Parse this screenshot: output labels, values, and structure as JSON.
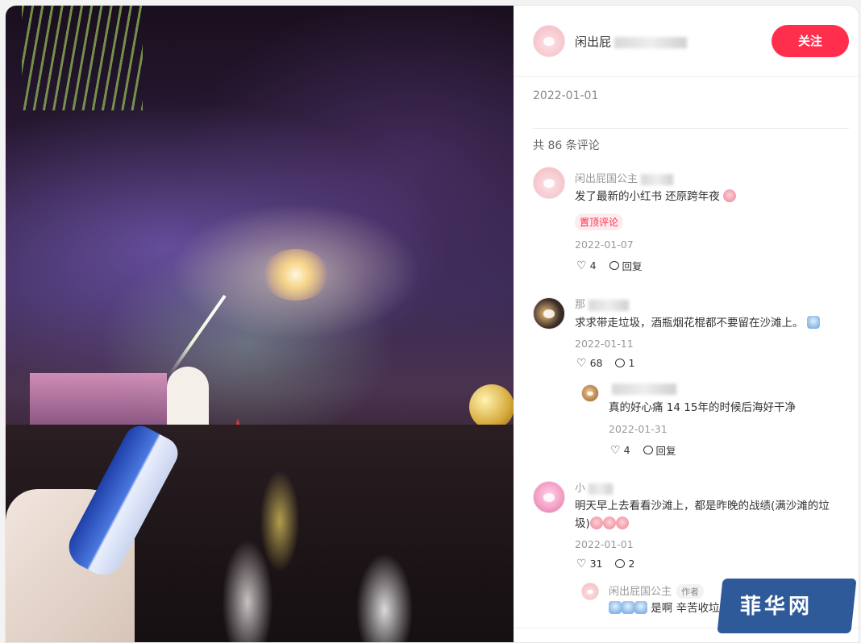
{
  "author": {
    "name": "闲出屁",
    "follow_label": "关注"
  },
  "post": {
    "date": "2022-01-01",
    "comment_count": "共 86 条评论"
  },
  "comments": [
    {
      "name": "闲出屁国公主",
      "text": "发了最新的小红书 还原跨年夜",
      "badge": "置顶评论",
      "date": "2022-01-07",
      "likes": "4",
      "reply_label": "回复"
    },
    {
      "name": "那",
      "text": "求求带走垃圾，酒瓶烟花棍都不要留在沙滩上。",
      "date": "2022-01-11",
      "likes": "68",
      "replies": "1"
    },
    {
      "name": "",
      "text": "真的好心痛 14 15年的时候后海好干净",
      "date": "2022-01-31",
      "likes": "4",
      "reply_label": "回复"
    },
    {
      "name": "小",
      "text_line1": "明天早上去看看沙滩上，都是昨晚的战绩(满沙滩的垃",
      "text_line2": "圾)",
      "date": "2022-01-01",
      "likes": "31",
      "replies": "2"
    },
    {
      "name": "闲出屁国公主",
      "tag": "作者",
      "text": "是啊 辛苦收垃"
    }
  ],
  "watermark": "菲华网"
}
